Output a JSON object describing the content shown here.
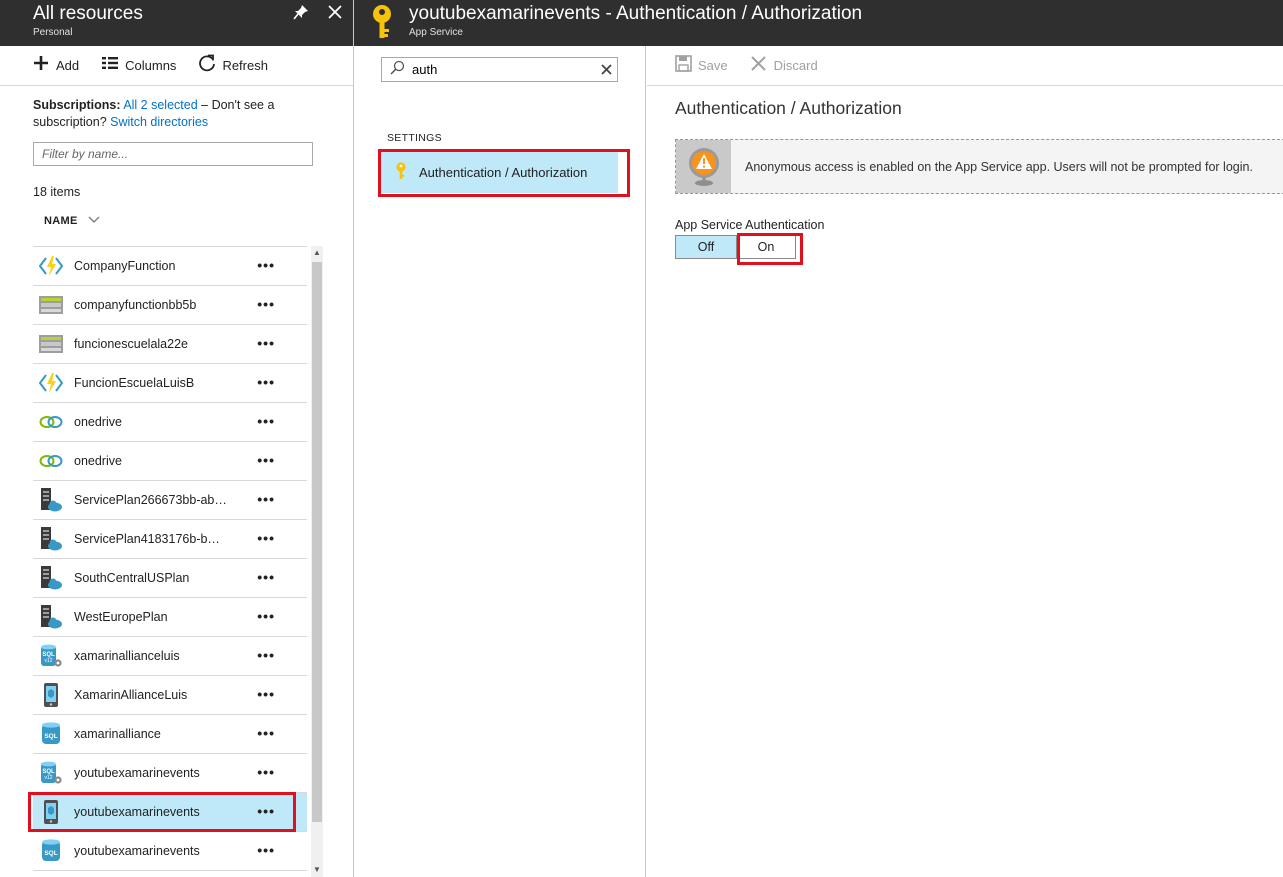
{
  "left_blade": {
    "title": "All resources",
    "subtitle": "Personal",
    "toolbar": {
      "add": "Add",
      "columns": "Columns",
      "refresh": "Refresh"
    },
    "subscriptions": {
      "label": "Subscriptions:",
      "selected": "All 2 selected",
      "dash_text": " – Don't see a subscription? ",
      "switch": "Switch directories"
    },
    "filter_placeholder": "Filter by name...",
    "count": "18 items",
    "name_header": "NAME",
    "items": [
      {
        "name": "CompanyFunction",
        "icon": "function-app-icon"
      },
      {
        "name": "companyfunctionbb5b",
        "icon": "storage-account-icon"
      },
      {
        "name": "funcionescuelala22e",
        "icon": "storage-account-icon"
      },
      {
        "name": "FuncionEscuelaLuisB",
        "icon": "function-app-icon"
      },
      {
        "name": "onedrive",
        "icon": "api-connection-icon"
      },
      {
        "name": "onedrive",
        "icon": "api-connection-icon"
      },
      {
        "name": "ServicePlan266673bb-ab…",
        "icon": "app-service-plan-icon"
      },
      {
        "name": "ServicePlan4183176b-b…",
        "icon": "app-service-plan-icon"
      },
      {
        "name": "SouthCentralUSPlan",
        "icon": "app-service-plan-icon"
      },
      {
        "name": "WestEuropePlan",
        "icon": "app-service-plan-icon"
      },
      {
        "name": "xamarinallianceluis",
        "icon": "sql-server-icon"
      },
      {
        "name": "XamarinAllianceLuis",
        "icon": "mobile-app-icon"
      },
      {
        "name": "xamarinalliance",
        "icon": "sql-database-icon"
      },
      {
        "name": "youtubexamarinevents",
        "icon": "sql-server-icon"
      },
      {
        "name": "youtubexamarinevents",
        "icon": "mobile-app-icon",
        "selected": true
      },
      {
        "name": "youtubexamarinevents",
        "icon": "sql-database-icon"
      }
    ],
    "more_label": "•••"
  },
  "middle_blade": {
    "search_value": "auth",
    "section": "SETTINGS",
    "menu_item": "Authentication / Authorization"
  },
  "right_blade": {
    "title": "youtubexamarinevents - Authentication / Authorization",
    "subtitle": "App Service",
    "toolbar": {
      "save": "Save",
      "discard": "Discard"
    },
    "heading": "Authentication / Authorization",
    "notice": "Anonymous access is enabled on the App Service app. Users will not be prompted for login.",
    "auth_label": "App Service Authentication",
    "toggle_off": "Off",
    "toggle_on": "On"
  },
  "colors": {
    "header_bg": "#2f2f2f",
    "selection_bg": "#bfe8f8",
    "link": "#0072c6",
    "highlight_box": "#e0101e",
    "warning": "#f7941d"
  }
}
